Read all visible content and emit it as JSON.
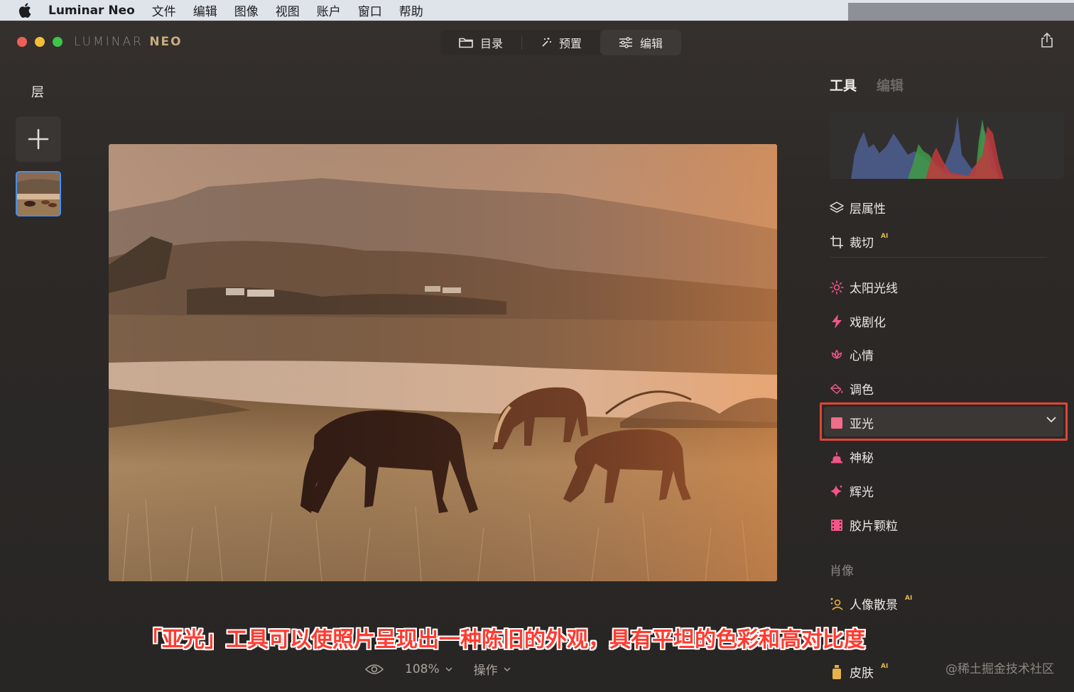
{
  "menubar": {
    "app_name": "Luminar Neo",
    "items": [
      "文件",
      "编辑",
      "图像",
      "视图",
      "账户",
      "窗口",
      "帮助"
    ]
  },
  "window": {
    "brand_left": "LUMINAR",
    "brand_right": "NEO",
    "nav": [
      {
        "label": "目录",
        "icon": "folder-icon"
      },
      {
        "label": "预置",
        "icon": "magic-wand-icon"
      },
      {
        "label": "编辑",
        "icon": "sliders-icon",
        "active": true
      }
    ]
  },
  "layers": {
    "title": "层"
  },
  "right_panel": {
    "tabs": {
      "tools": "工具",
      "edits": "编辑"
    },
    "tools_group1": [
      {
        "label": "层属性",
        "icon": "layers-icon"
      },
      {
        "label": "裁切",
        "icon": "crop-icon",
        "ai": "AI"
      }
    ],
    "tools_group2": [
      {
        "label": "太阳光线",
        "icon": "sun-icon",
        "color": "#f0558a"
      },
      {
        "label": "戏剧化",
        "icon": "lightning-icon",
        "color": "#f0558a"
      },
      {
        "label": "心情",
        "icon": "lotus-icon",
        "color": "#f0558a"
      },
      {
        "label": "调色",
        "icon": "paint-bucket-icon",
        "color": "#f0558a"
      },
      {
        "label": "亚光",
        "icon": "matte-square-icon",
        "color": "#f06d8c",
        "selected": true
      },
      {
        "label": "神秘",
        "icon": "mystic-icon",
        "color": "#f0558a"
      },
      {
        "label": "辉光",
        "icon": "sparkle-icon",
        "color": "#f0558a"
      },
      {
        "label": "胶片颗粒",
        "icon": "film-icon",
        "color": "#f0558a"
      }
    ],
    "section_portrait": "肖像",
    "portrait_tools": [
      {
        "label": "人像散景",
        "icon": "portrait-bokeh-icon",
        "ai": "AI",
        "color": "#e7b14a"
      },
      {
        "label": "皮肤",
        "icon": "skin-bottle-icon",
        "ai": "AI",
        "color": "#e7b14a"
      }
    ]
  },
  "bottom": {
    "zoom": "108%",
    "actions": "操作"
  },
  "caption": "「亚光」工具可以使照片呈现出一种陈旧的外观，具有平坦的色彩和高对比度",
  "watermark": "@稀土掘金技术社区"
}
